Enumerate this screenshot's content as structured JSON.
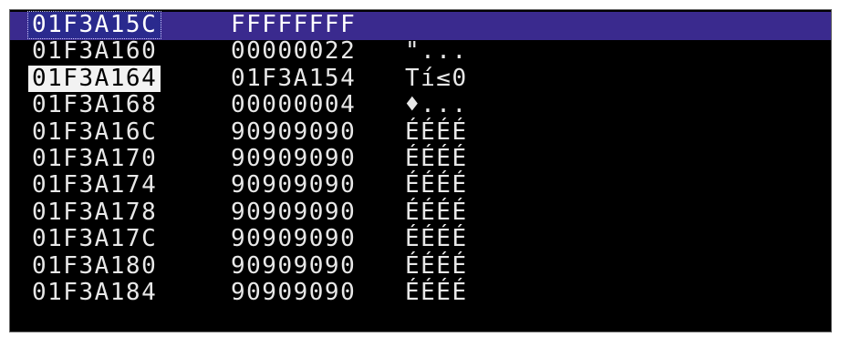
{
  "panel": {
    "rows": [
      {
        "address": "01F3A15C",
        "value": "FFFFFFFF",
        "ascii": ""
      },
      {
        "address": "01F3A160",
        "value": "00000022",
        "ascii": "\"..."
      },
      {
        "address": "01F3A164",
        "value": "01F3A154",
        "ascii": "Tí≤0"
      },
      {
        "address": "01F3A168",
        "value": "00000004",
        "ascii": "♦..."
      },
      {
        "address": "01F3A16C",
        "value": "90909090",
        "ascii": "ÉÉÉÉ"
      },
      {
        "address": "01F3A170",
        "value": "90909090",
        "ascii": "ÉÉÉÉ"
      },
      {
        "address": "01F3A174",
        "value": "90909090",
        "ascii": "ÉÉÉÉ"
      },
      {
        "address": "01F3A178",
        "value": "90909090",
        "ascii": "ÉÉÉÉ"
      },
      {
        "address": "01F3A17C",
        "value": "90909090",
        "ascii": "ÉÉÉÉ"
      },
      {
        "address": "01F3A180",
        "value": "90909090",
        "ascii": "ÉÉÉÉ"
      },
      {
        "address": "01F3A184",
        "value": "90909090",
        "ascii": "ÉÉÉÉ"
      }
    ],
    "selected_row_index": 0,
    "current_row_index": 2
  },
  "colors": {
    "background": "#000000",
    "selection": "#3a2a8e",
    "text": "#e8e8e8",
    "current_address_bg": "#f2f2f2"
  }
}
